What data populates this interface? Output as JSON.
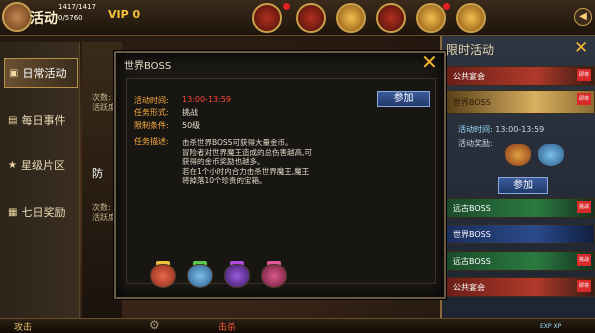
{
  "hud": {
    "title": "活动",
    "hp_text": "1417/1417",
    "mp_text": "0/5760",
    "vip_label": "VIP",
    "vip_level": "0",
    "icons": [
      "boss-icon",
      "event-icon",
      "treasure-icon",
      "gift-icon",
      "gold-icon",
      "expand-arrow-icon"
    ]
  },
  "left_tabs": [
    {
      "label": "日常活动",
      "icon": "calendar-icon",
      "active": true
    },
    {
      "label": "每日事件",
      "icon": "book-icon",
      "active": false
    },
    {
      "label": "星级片区",
      "icon": "star-icon",
      "active": false
    },
    {
      "label": "七日奖励",
      "icon": "gift-icon",
      "active": false
    }
  ],
  "background_text": {
    "line1": "次数:",
    "line2": "活跃度",
    "line3": "防",
    "line4": "次数:",
    "line5": "活跃度"
  },
  "right_panel": {
    "title": "限时活动",
    "activities": [
      {
        "name": "公共宴会",
        "badge": "即将",
        "style": "red"
      },
      {
        "name": "世界BOSS",
        "badge": "即将",
        "style": "gold"
      },
      {
        "name": "远古BOSS",
        "badge": "挑战",
        "style": "green"
      },
      {
        "name": "世界BOSS",
        "badge": "",
        "style": "blue"
      },
      {
        "name": "远古BOSS",
        "badge": "挑战",
        "style": "green"
      },
      {
        "name": "公共宴会",
        "badge": "即将",
        "style": "red"
      }
    ],
    "time_label": "活动时间:",
    "time_value": "13:00-13:59",
    "reward_label": "活动奖励:",
    "join_button": "参加"
  },
  "modal": {
    "title": "世界BOSS",
    "fields": [
      {
        "label": "活动时间:",
        "value": "13:00-13:59",
        "highlight": true
      },
      {
        "label": "任务形式:",
        "value": "挑战",
        "highlight": false
      },
      {
        "label": "限制条件:",
        "value": "50级",
        "highlight": false
      },
      {
        "label": "任务描述:",
        "value": "",
        "highlight": false
      }
    ],
    "description_lines": [
      "击杀世界BOSS可获得大量金币。",
      "冒险者对世界魔王造成的总伤害越高,可获得的金币奖励也越多。",
      "若在1个小时内合力击杀世界魔王,魔王将掉落10个珍贵的宝箱。"
    ],
    "join_button": "参加",
    "rewards": [
      {
        "name": "treasure-bag-red",
        "color": "#c83a3a"
      },
      {
        "name": "treasure-bag-blue",
        "color": "#4a7ac8"
      },
      {
        "name": "treasure-bag-purple",
        "color": "#7a3ab0"
      },
      {
        "name": "treasure-bag-pink",
        "color": "#b03a6a"
      }
    ]
  },
  "bottom": {
    "left_text": "攻击",
    "mid_text": "击杀",
    "exp_text": "EXP",
    "xp_text": "XP"
  }
}
